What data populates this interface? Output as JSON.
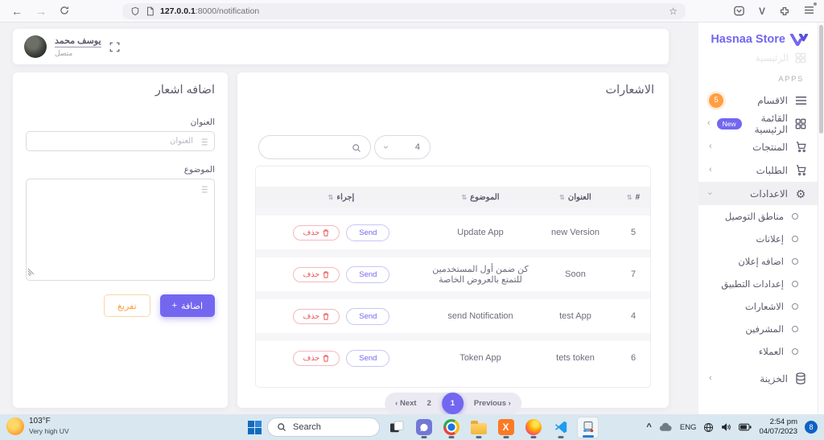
{
  "browser": {
    "url_host": "127.0.0.1",
    "url_rest": ":8000/notification",
    "star_glyph": "☆",
    "back_glyph": "←",
    "forward_glyph": "→",
    "v_icon_glyph": "V"
  },
  "header": {
    "user_name": "يوسف محمد",
    "user_status": "متصل"
  },
  "sidebar": {
    "brand": "Hasnaa Store",
    "faded_item": "الرئيسية",
    "section_label": "APPS",
    "chevron_glyph": "›",
    "items": [
      {
        "label": "الاقسام",
        "badge": "5"
      },
      {
        "label": "القائمة الرئيسية",
        "badge": "New"
      },
      {
        "label": "المنتجات"
      },
      {
        "label": "الطلبات"
      },
      {
        "label": "الاعدادات"
      }
    ],
    "settings_children": [
      {
        "label": "مناطق التوصيل"
      },
      {
        "label": "إعلانات"
      },
      {
        "label": "اضافه إعلان"
      },
      {
        "label": "إعدادات التطبيق"
      },
      {
        "label": "الاشعارات"
      },
      {
        "label": "المشرفين"
      },
      {
        "label": "العملاء"
      }
    ],
    "treasury_label": "الخزينة"
  },
  "add_form": {
    "title": "اضافه اشعار",
    "title_label": "العنوان",
    "title_placeholder": "العنوان",
    "subject_label": "الموضوع",
    "clear_button": "تفريغ",
    "add_button": "اضافة",
    "add_plus": "+"
  },
  "notifications": {
    "title": "الاشعارات",
    "per_page": "4",
    "sort_glyph": "⇅",
    "columns": {
      "id": "#",
      "title": "العنوان",
      "subject": "الموضوع",
      "action": "إجراء"
    },
    "send_label": "Send",
    "delete_label": "حذف",
    "rows": [
      {
        "id": "5",
        "title": "new Version",
        "subject": "Update App"
      },
      {
        "id": "7",
        "title": "Soon",
        "subject": "كن ضمن أول المستخدمين للتمتع بالعروض الخاصة"
      },
      {
        "id": "4",
        "title": "test App",
        "subject": "send Notification"
      },
      {
        "id": "6",
        "title": "tets token",
        "subject": "Token App"
      }
    ],
    "pagination": {
      "next": "‹ Next",
      "page2": "2",
      "page1": "1",
      "previous": "Previous ›"
    }
  },
  "taskbar": {
    "temperature": "103°F",
    "weather_detail": "Very high UV",
    "search_placeholder": "Search",
    "xampp_glyph": "X",
    "language": "ENG",
    "chevron_glyph": "^",
    "time": "2:54 pm",
    "date": "04/07/2023",
    "notification_count": "8"
  },
  "colors": {
    "accent": "#7367f0",
    "warning": "#ff9f43",
    "danger": "#ea5455"
  }
}
